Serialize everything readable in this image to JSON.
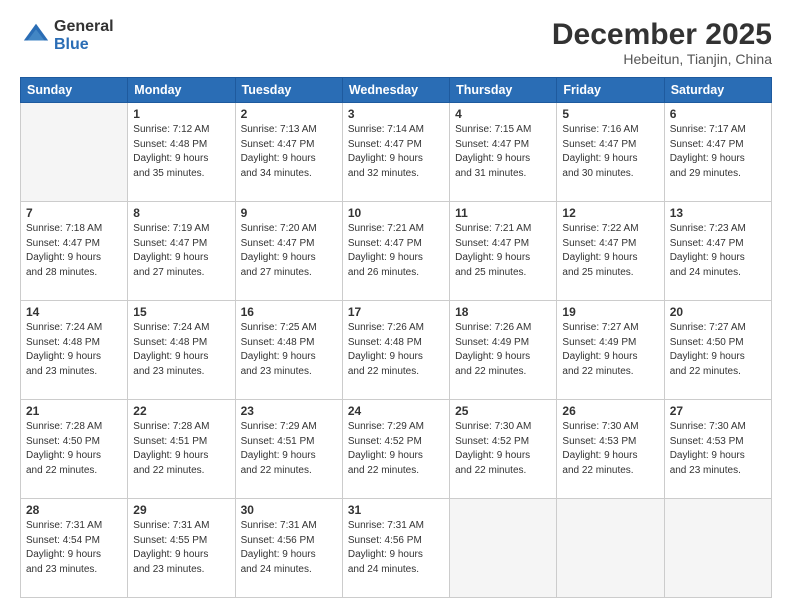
{
  "header": {
    "logo_line1": "General",
    "logo_line2": "Blue",
    "month": "December 2025",
    "location": "Hebeitun, Tianjin, China"
  },
  "weekdays": [
    "Sunday",
    "Monday",
    "Tuesday",
    "Wednesday",
    "Thursday",
    "Friday",
    "Saturday"
  ],
  "weeks": [
    [
      {
        "day": "",
        "info": ""
      },
      {
        "day": "1",
        "info": "Sunrise: 7:12 AM\nSunset: 4:48 PM\nDaylight: 9 hours\nand 35 minutes."
      },
      {
        "day": "2",
        "info": "Sunrise: 7:13 AM\nSunset: 4:47 PM\nDaylight: 9 hours\nand 34 minutes."
      },
      {
        "day": "3",
        "info": "Sunrise: 7:14 AM\nSunset: 4:47 PM\nDaylight: 9 hours\nand 32 minutes."
      },
      {
        "day": "4",
        "info": "Sunrise: 7:15 AM\nSunset: 4:47 PM\nDaylight: 9 hours\nand 31 minutes."
      },
      {
        "day": "5",
        "info": "Sunrise: 7:16 AM\nSunset: 4:47 PM\nDaylight: 9 hours\nand 30 minutes."
      },
      {
        "day": "6",
        "info": "Sunrise: 7:17 AM\nSunset: 4:47 PM\nDaylight: 9 hours\nand 29 minutes."
      }
    ],
    [
      {
        "day": "7",
        "info": "Sunrise: 7:18 AM\nSunset: 4:47 PM\nDaylight: 9 hours\nand 28 minutes."
      },
      {
        "day": "8",
        "info": "Sunrise: 7:19 AM\nSunset: 4:47 PM\nDaylight: 9 hours\nand 27 minutes."
      },
      {
        "day": "9",
        "info": "Sunrise: 7:20 AM\nSunset: 4:47 PM\nDaylight: 9 hours\nand 27 minutes."
      },
      {
        "day": "10",
        "info": "Sunrise: 7:21 AM\nSunset: 4:47 PM\nDaylight: 9 hours\nand 26 minutes."
      },
      {
        "day": "11",
        "info": "Sunrise: 7:21 AM\nSunset: 4:47 PM\nDaylight: 9 hours\nand 25 minutes."
      },
      {
        "day": "12",
        "info": "Sunrise: 7:22 AM\nSunset: 4:47 PM\nDaylight: 9 hours\nand 25 minutes."
      },
      {
        "day": "13",
        "info": "Sunrise: 7:23 AM\nSunset: 4:47 PM\nDaylight: 9 hours\nand 24 minutes."
      }
    ],
    [
      {
        "day": "14",
        "info": "Sunrise: 7:24 AM\nSunset: 4:48 PM\nDaylight: 9 hours\nand 23 minutes."
      },
      {
        "day": "15",
        "info": "Sunrise: 7:24 AM\nSunset: 4:48 PM\nDaylight: 9 hours\nand 23 minutes."
      },
      {
        "day": "16",
        "info": "Sunrise: 7:25 AM\nSunset: 4:48 PM\nDaylight: 9 hours\nand 23 minutes."
      },
      {
        "day": "17",
        "info": "Sunrise: 7:26 AM\nSunset: 4:48 PM\nDaylight: 9 hours\nand 22 minutes."
      },
      {
        "day": "18",
        "info": "Sunrise: 7:26 AM\nSunset: 4:49 PM\nDaylight: 9 hours\nand 22 minutes."
      },
      {
        "day": "19",
        "info": "Sunrise: 7:27 AM\nSunset: 4:49 PM\nDaylight: 9 hours\nand 22 minutes."
      },
      {
        "day": "20",
        "info": "Sunrise: 7:27 AM\nSunset: 4:50 PM\nDaylight: 9 hours\nand 22 minutes."
      }
    ],
    [
      {
        "day": "21",
        "info": "Sunrise: 7:28 AM\nSunset: 4:50 PM\nDaylight: 9 hours\nand 22 minutes."
      },
      {
        "day": "22",
        "info": "Sunrise: 7:28 AM\nSunset: 4:51 PM\nDaylight: 9 hours\nand 22 minutes."
      },
      {
        "day": "23",
        "info": "Sunrise: 7:29 AM\nSunset: 4:51 PM\nDaylight: 9 hours\nand 22 minutes."
      },
      {
        "day": "24",
        "info": "Sunrise: 7:29 AM\nSunset: 4:52 PM\nDaylight: 9 hours\nand 22 minutes."
      },
      {
        "day": "25",
        "info": "Sunrise: 7:30 AM\nSunset: 4:52 PM\nDaylight: 9 hours\nand 22 minutes."
      },
      {
        "day": "26",
        "info": "Sunrise: 7:30 AM\nSunset: 4:53 PM\nDaylight: 9 hours\nand 22 minutes."
      },
      {
        "day": "27",
        "info": "Sunrise: 7:30 AM\nSunset: 4:53 PM\nDaylight: 9 hours\nand 23 minutes."
      }
    ],
    [
      {
        "day": "28",
        "info": "Sunrise: 7:31 AM\nSunset: 4:54 PM\nDaylight: 9 hours\nand 23 minutes."
      },
      {
        "day": "29",
        "info": "Sunrise: 7:31 AM\nSunset: 4:55 PM\nDaylight: 9 hours\nand 23 minutes."
      },
      {
        "day": "30",
        "info": "Sunrise: 7:31 AM\nSunset: 4:56 PM\nDaylight: 9 hours\nand 24 minutes."
      },
      {
        "day": "31",
        "info": "Sunrise: 7:31 AM\nSunset: 4:56 PM\nDaylight: 9 hours\nand 24 minutes."
      },
      {
        "day": "",
        "info": ""
      },
      {
        "day": "",
        "info": ""
      },
      {
        "day": "",
        "info": ""
      }
    ]
  ]
}
